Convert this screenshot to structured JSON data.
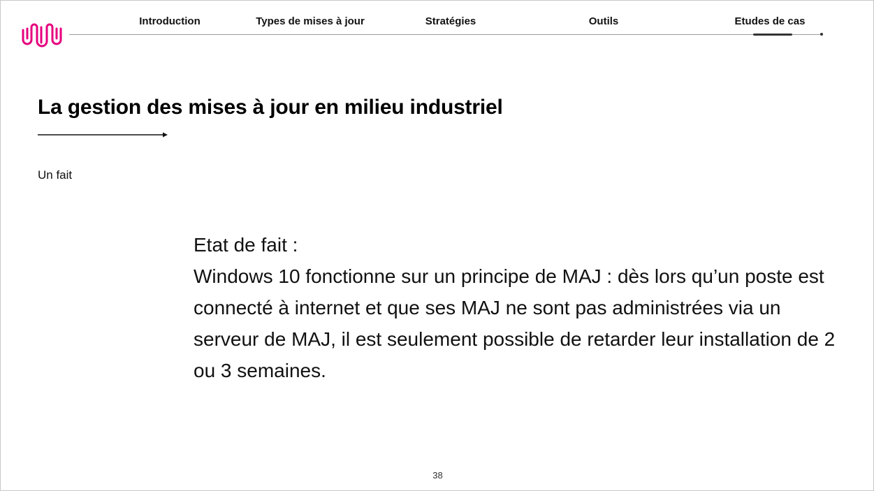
{
  "brand": {
    "logo_icon": "wave-logo-icon",
    "accent_color": "#e6007e"
  },
  "nav": {
    "items": [
      {
        "label": "Introduction"
      },
      {
        "label": "Types de mises à jour"
      },
      {
        "label": "Stratégies"
      },
      {
        "label": "Outils"
      },
      {
        "label": "Etudes de cas"
      }
    ],
    "active_index": 4
  },
  "slide": {
    "title": "La gestion des mises à jour en milieu industriel",
    "section_label": "Un fait",
    "body": {
      "heading": "Etat de fait :",
      "paragraph": "Windows 10 fonctionne sur un principe de MAJ : dès lors qu’un poste est connecté à internet et que ses MAJ ne sont pas administrées via un serveur de MAJ, il est seulement possible de retarder leur installation de 2 ou 3 semaines."
    },
    "page_number": "38"
  }
}
